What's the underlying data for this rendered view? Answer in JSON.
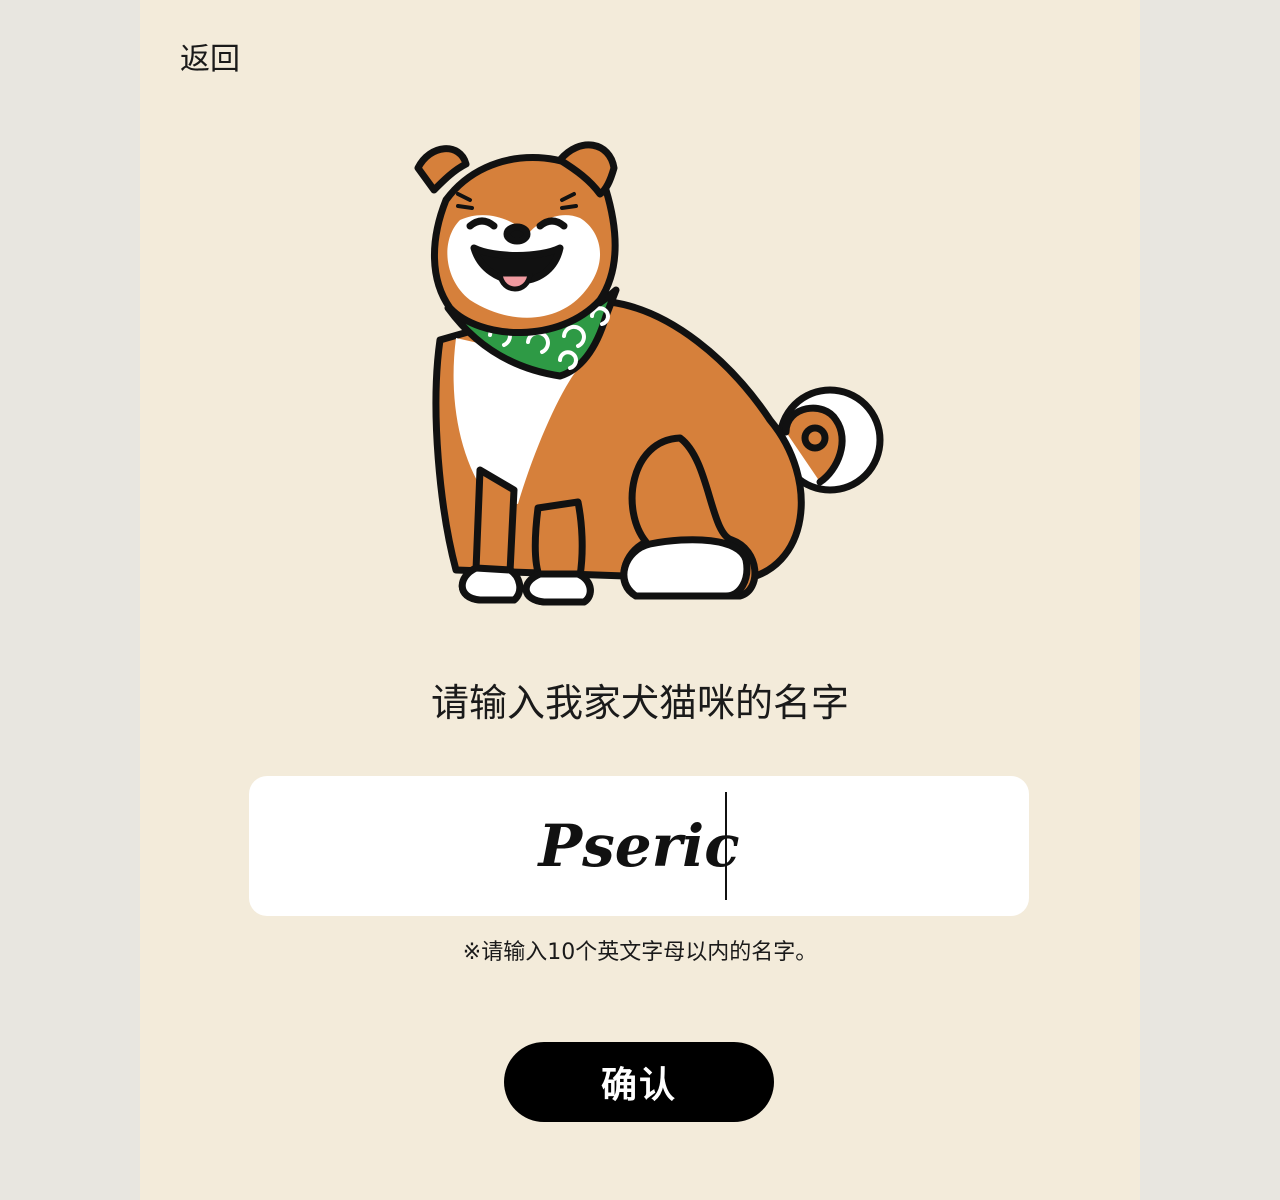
{
  "header": {
    "back_label": "返回"
  },
  "main": {
    "prompt": "请输入我家犬猫咪的名字",
    "name_input": {
      "value": "Pseric"
    },
    "hint": "※请输入10个英文字母以内的名字。",
    "confirm_label": "确认"
  },
  "illustration": {
    "icon": "shiba-dog-with-green-bandana-icon"
  },
  "colors": {
    "page_bg": "#e8e6e0",
    "panel_bg": "#f3ebda",
    "input_bg": "#ffffff",
    "button_bg": "#000000",
    "dog_fur": "#d6803b",
    "bandana": "#2e9a45"
  }
}
